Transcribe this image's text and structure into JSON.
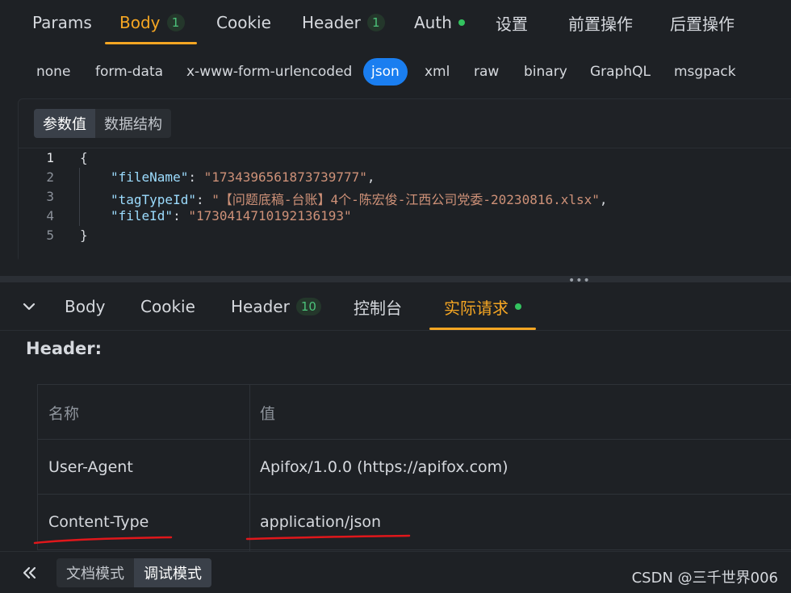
{
  "top_tabs": [
    {
      "label": "Params"
    },
    {
      "label": "Body",
      "badge": "1",
      "active": true
    },
    {
      "label": "Cookie"
    },
    {
      "label": "Header",
      "badge": "1"
    },
    {
      "label": "Auth"
    },
    {
      "label": "设置"
    },
    {
      "label": "前置操作"
    },
    {
      "label": "后置操作"
    }
  ],
  "body_types": [
    "none",
    "form-data",
    "x-www-form-urlencoded",
    "json",
    "xml",
    "raw",
    "binary",
    "GraphQL",
    "msgpack"
  ],
  "body_type_selected": "json",
  "editor": {
    "segments": [
      "参数值",
      "数据结构"
    ],
    "lines": [
      {
        "n": "1",
        "text": "{"
      },
      {
        "n": "2",
        "key": "\"fileName\"",
        "value": "\"1734396561873739777\"",
        "trail": ","
      },
      {
        "n": "3",
        "key": "\"tagTypeId\"",
        "value": "\"【问题底稿-台账】4个-陈宏俊-江西公司党委-20230816.xlsx\"",
        "trail": ","
      },
      {
        "n": "4",
        "key": "\"fileId\"",
        "value": "\"1730414710192136193\"",
        "trail": ""
      },
      {
        "n": "5",
        "text": "}"
      }
    ]
  },
  "splitter_grip": "•••",
  "bottom_tabs": [
    {
      "label": "Body"
    },
    {
      "label": "Cookie"
    },
    {
      "label": "Header",
      "badge": "10"
    },
    {
      "label": "控制台"
    },
    {
      "label": "实际请求",
      "active": true
    }
  ],
  "header_section": {
    "title": "Header:",
    "columns": [
      "名称",
      "值"
    ],
    "rows": [
      {
        "name": "User-Agent",
        "value": "Apifox/1.0.0 (https://apifox.com)"
      },
      {
        "name": "Content-Type",
        "value": "application/json"
      }
    ]
  },
  "footer": {
    "modes": [
      "文档模式",
      "调试模式"
    ],
    "active_mode": "调试模式",
    "watermark": "CSDN @三千世界006"
  },
  "colors": {
    "accent": "#f5a623",
    "selected": "#1a7ef0",
    "status_dot": "#33c35f",
    "annotation": "#e0171b"
  },
  "icons": [
    "chevron-down-icon",
    "double-chevron-left-icon",
    "status-dot-icon"
  ]
}
